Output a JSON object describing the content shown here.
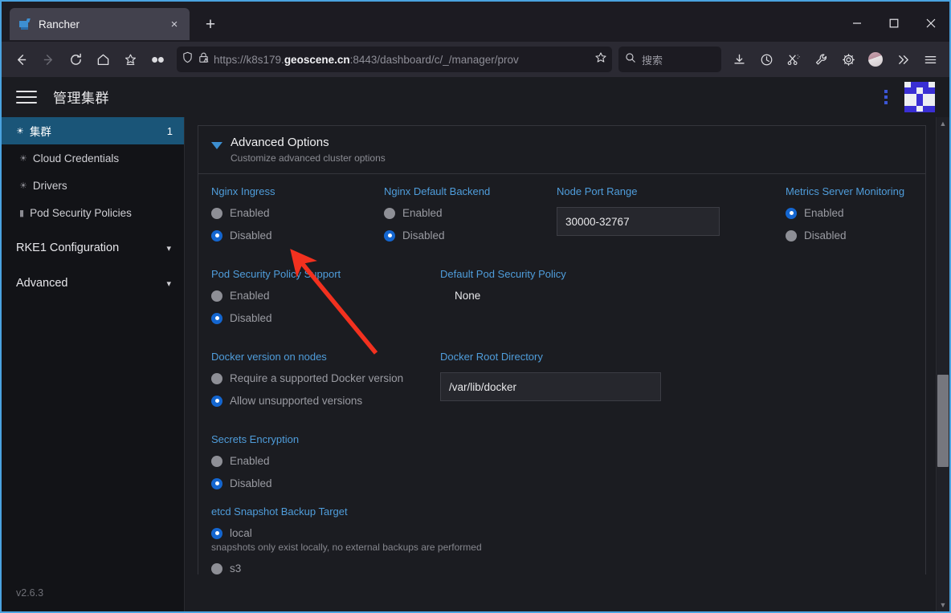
{
  "browser": {
    "tab": {
      "title": "Rancher",
      "favicon": "rancher-favicon",
      "close_label": "×"
    },
    "new_tab_label": "+",
    "window_controls": {
      "minimize": "minimize-icon",
      "maximize": "maximize-icon",
      "close": "close-icon"
    },
    "nav": {
      "back": "back-arrow-icon",
      "forward": "forward-arrow-icon",
      "reload": "reload-icon",
      "home": "home-icon",
      "bookmarks": "bookmark-star-icon",
      "pocket": "infinity-icon"
    },
    "url": {
      "prefix": "https://k8s179.",
      "host_bold": "geoscene.cn",
      "suffix": ":8443/dashboard/c/_/manager/prov",
      "shield_icon": "shield-icon",
      "lock_icon": "lock-warning-icon",
      "star_icon": "bookmark-star-icon"
    },
    "search": {
      "placeholder": "搜索",
      "icon": "search-icon"
    },
    "toolbar_icons": [
      "download-icon",
      "history-clock-icon",
      "screenshot-icon",
      "wrench-icon",
      "gear-icon",
      "account-avatar-icon",
      "overflow-chevrons-icon",
      "hamburger-menu-icon"
    ]
  },
  "app": {
    "menu_icon": "hamburger-menu-icon",
    "title": "管理集群",
    "kebab_icon": "vertical-dots-icon",
    "avatar": "user-identicon",
    "version": "v2.6.3"
  },
  "sidebar": {
    "items": [
      {
        "label": "集群",
        "icon": "globe-icon",
        "count": "1",
        "active": true
      },
      {
        "label": "Cloud Credentials",
        "icon": "globe-icon",
        "count": "",
        "active": false
      },
      {
        "label": "Drivers",
        "icon": "globe-icon",
        "count": "",
        "active": false
      },
      {
        "label": "Pod Security Policies",
        "icon": "folder-icon",
        "count": "",
        "active": false
      }
    ],
    "groups": [
      {
        "label": "RKE1 Configuration",
        "chevron": "chevron-down-icon"
      },
      {
        "label": "Advanced",
        "chevron": "chevron-down-icon"
      }
    ]
  },
  "panel": {
    "title": "Advanced Options",
    "subtitle": "Customize advanced cluster options",
    "toggle_icon": "triangle-down-icon"
  },
  "form": {
    "nginx_ingress": {
      "label": "Nginx Ingress",
      "options": [
        {
          "label": "Enabled",
          "selected": false
        },
        {
          "label": "Disabled",
          "selected": true
        }
      ]
    },
    "nginx_default_backend": {
      "label": "Nginx Default Backend",
      "options": [
        {
          "label": "Enabled",
          "selected": false
        },
        {
          "label": "Disabled",
          "selected": true
        }
      ]
    },
    "node_port_range": {
      "label": "Node Port Range",
      "value": "30000-32767"
    },
    "metrics_server_monitoring": {
      "label": "Metrics Server Monitoring",
      "options": [
        {
          "label": "Enabled",
          "selected": true
        },
        {
          "label": "Disabled",
          "selected": false
        }
      ]
    },
    "psp_support": {
      "label": "Pod Security Policy Support",
      "options": [
        {
          "label": "Enabled",
          "selected": false
        },
        {
          "label": "Disabled",
          "selected": true
        }
      ]
    },
    "default_psp": {
      "label": "Default Pod Security Policy",
      "value": "None"
    },
    "docker_version": {
      "label": "Docker version on nodes",
      "options": [
        {
          "label": "Require a supported Docker version",
          "selected": false
        },
        {
          "label": "Allow unsupported versions",
          "selected": true
        }
      ]
    },
    "docker_root_dir": {
      "label": "Docker Root Directory",
      "value": "/var/lib/docker"
    },
    "secrets_encryption": {
      "label": "Secrets Encryption",
      "options": [
        {
          "label": "Enabled",
          "selected": false
        },
        {
          "label": "Disabled",
          "selected": true
        }
      ]
    },
    "etcd_backup_target": {
      "label": "etcd Snapshot Backup Target",
      "options": [
        {
          "label": "local",
          "selected": true,
          "helper": "snapshots only exist locally, no external backups are performed"
        },
        {
          "label": "s3",
          "selected": false,
          "helper": ""
        }
      ]
    }
  },
  "colors": {
    "accent_blue": "#4f9ddb",
    "radio_on": "#1466d0",
    "sidebar_active": "#1a5578",
    "annotation_red": "#f2311f"
  }
}
